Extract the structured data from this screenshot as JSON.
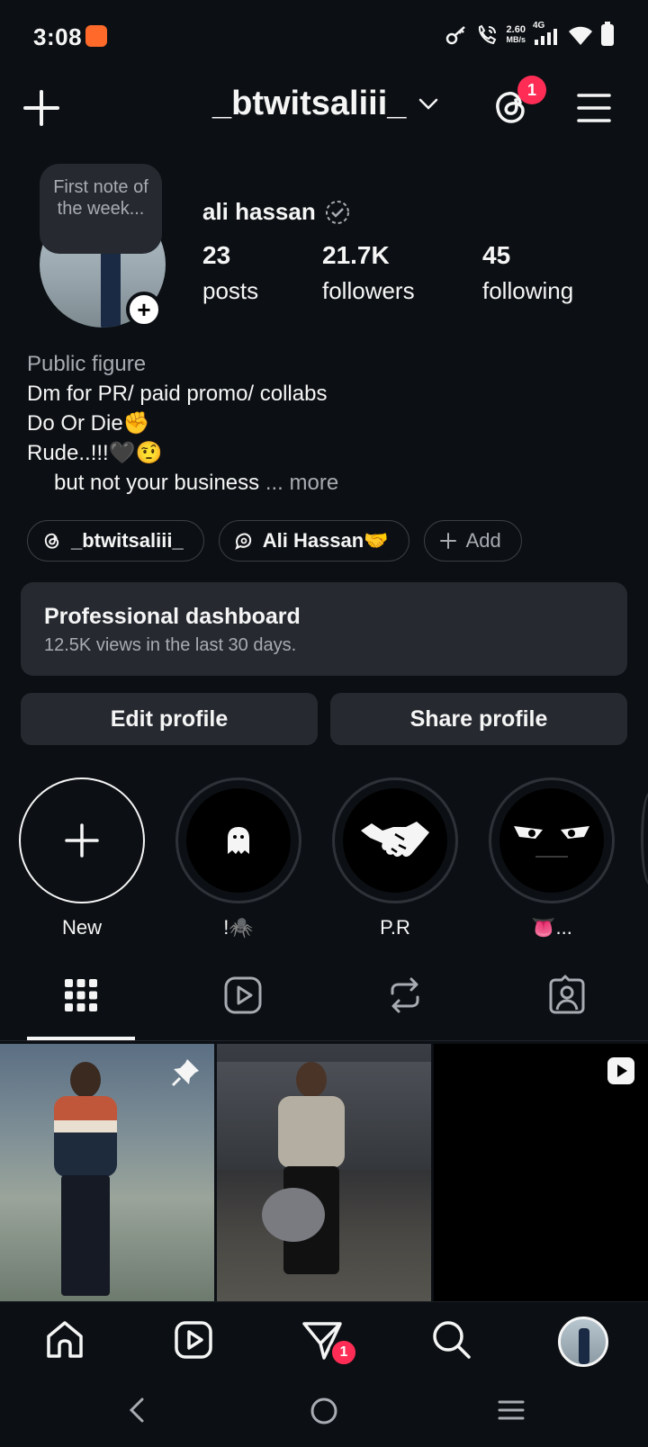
{
  "status_bar": {
    "time": "3:08",
    "net_speed_value": "2.60",
    "net_speed_unit": "MB/s",
    "network": "4G"
  },
  "header": {
    "username": "_btwitsaliii_",
    "threads_badge_count": "1"
  },
  "profile": {
    "note": "First note of the week...",
    "display_name": "ali hassan",
    "stats": [
      {
        "value": "23",
        "label": "posts"
      },
      {
        "value": "21.7K",
        "label": "followers"
      },
      {
        "value": "45",
        "label": "following"
      }
    ],
    "bio": {
      "category": "Public figure",
      "line1": "Dm for PR/ paid promo/ collabs",
      "line2": "Do Or Die✊",
      "line3": "Rude..!!!🖤🤨",
      "line4": "but not your business",
      "more": "... more"
    },
    "chips": {
      "threads": "_btwitsaliii_",
      "link": "Ali Hassan🤝",
      "add": "Add"
    }
  },
  "dashboard": {
    "title": "Professional dashboard",
    "subtitle": "12.5K views in the last 30 days."
  },
  "actions": {
    "edit": "Edit profile",
    "share": "Share profile"
  },
  "highlights": [
    {
      "label": "New",
      "icon": "plus-icon"
    },
    {
      "label": "!🕷️",
      "icon": "ghost-icon"
    },
    {
      "label": "P.R",
      "icon": "handshake-icon"
    },
    {
      "label": "👅...",
      "icon": "angry-eyes-icon"
    }
  ],
  "tabs": [
    "grid-icon",
    "reels-icon",
    "reposts-icon",
    "tagged-icon"
  ],
  "bottom_nav": {
    "activity_badge": "1"
  },
  "colors": {
    "background": "#0c1014",
    "surface": "#262a30",
    "badge": "#ff2d55",
    "muted_text": "#a8acb2"
  }
}
